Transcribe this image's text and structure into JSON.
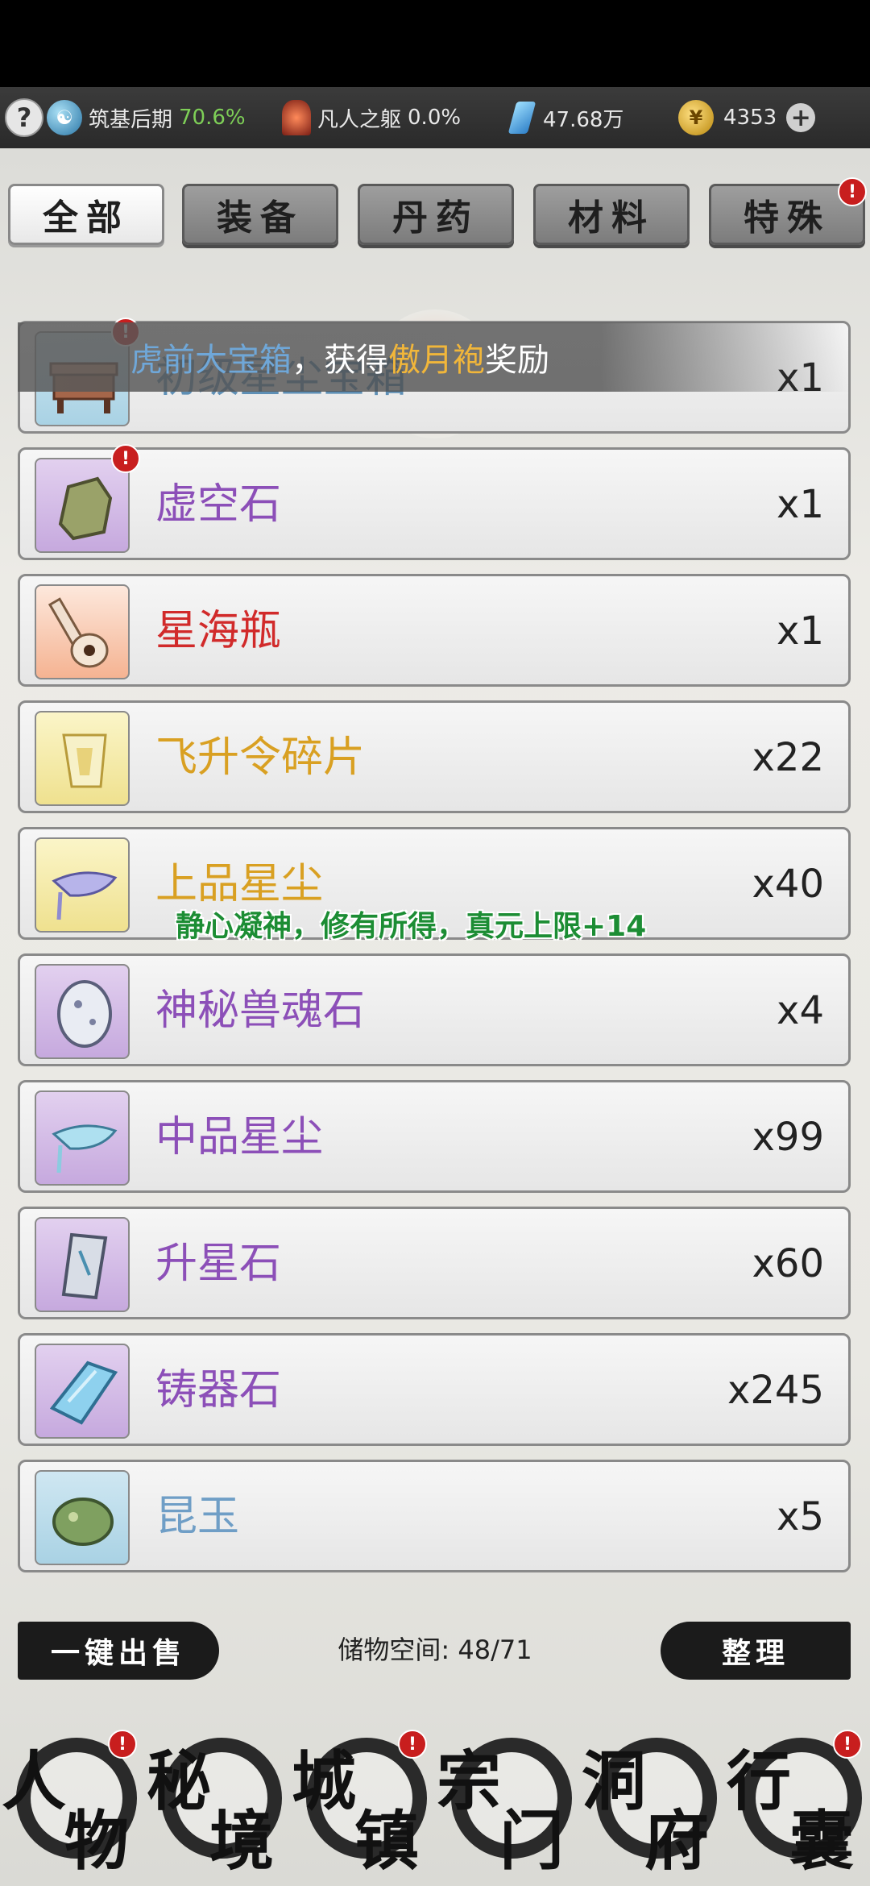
{
  "status": {
    "help": "?",
    "realm_label": "筑基后期",
    "realm_progress": "70.6%",
    "body_label": "凡人之躯",
    "body_progress": "0.0%",
    "spirit_stones": "47.68万",
    "coins": "4353",
    "plus": "+"
  },
  "tabs": [
    {
      "label": "全部",
      "active": true
    },
    {
      "label": "装备"
    },
    {
      "label": "丹药"
    },
    {
      "label": "材料"
    },
    {
      "label": "特殊",
      "badge": "!"
    }
  ],
  "badge_mark": "!",
  "toast": {
    "prefix": "虎前大宝箱",
    "mid": "，获得",
    "item": "傲月袍",
    "suffix": "奖励"
  },
  "float_text": "静心凝神，修有所得，真元上限+14",
  "items": [
    {
      "name": "初级星尘宝箱",
      "qty": "x1",
      "badge": "!"
    },
    {
      "name": "虚空石",
      "qty": "x1",
      "badge": "!"
    },
    {
      "name": "星海瓶",
      "qty": "x1"
    },
    {
      "name": "飞升令碎片",
      "qty": "x22"
    },
    {
      "name": "上品星尘",
      "qty": "x40"
    },
    {
      "name": "神秘兽魂石",
      "qty": "x4"
    },
    {
      "name": "中品星尘",
      "qty": "x99"
    },
    {
      "name": "升星石",
      "qty": "x60"
    },
    {
      "name": "铸器石",
      "qty": "x245"
    },
    {
      "name": "昆玉",
      "qty": "x5"
    }
  ],
  "footer": {
    "sell_all": "一键出售",
    "storage": "储物空间: 48/71",
    "organize": "整理"
  },
  "bottom_nav": [
    {
      "c1": "人",
      "c2": "物",
      "badge": "!"
    },
    {
      "c1": "秘",
      "c2": "境"
    },
    {
      "c1": "城",
      "c2": "镇",
      "badge": "!"
    },
    {
      "c1": "宗",
      "c2": "门"
    },
    {
      "c1": "洞",
      "c2": "府"
    },
    {
      "c1": "行",
      "c2": "囊",
      "badge": "!"
    }
  ]
}
